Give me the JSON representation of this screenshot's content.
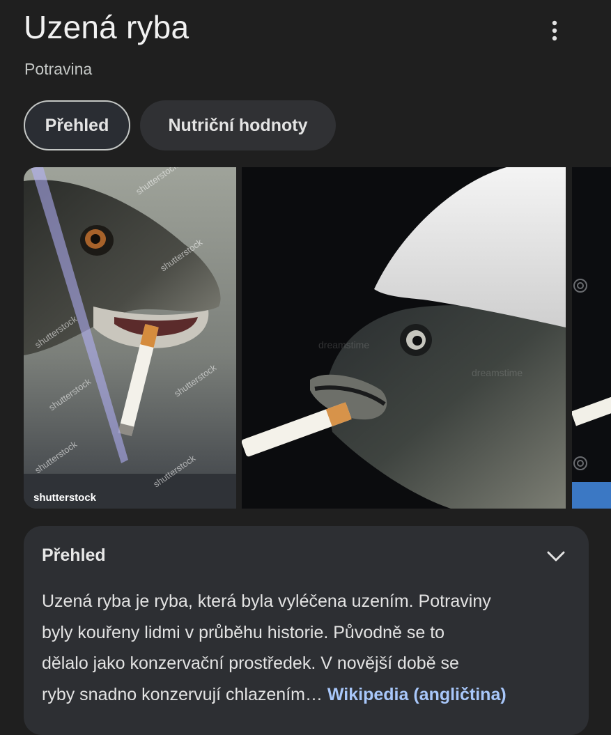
{
  "header": {
    "title": "Uzená ryba",
    "subtitle": "Potravina",
    "more_icon": "more-vert-icon"
  },
  "tabs": [
    {
      "label": "Přehled",
      "active": true
    },
    {
      "label": "Nutriční hodnoty",
      "active": false
    }
  ],
  "gallery": {
    "images": [
      {
        "subject": "fish with cigarette",
        "watermark": "shutterstock"
      },
      {
        "subject": "fish with cigarette and white cap"
      },
      {
        "subject": "partially visible image"
      }
    ]
  },
  "overview": {
    "heading": "Přehled",
    "chevron_icon": "chevron-down-icon",
    "lines": [
      "Uzená ryba je ryba, která byla vyléčena uzením. Potraviny",
      "byly kouřeny lidmi v průběhu historie. Původně se to",
      "dělalo jako konzervační prostředek. V novější době se",
      "ryby snadno konzervují chlazením"
    ],
    "ellipsis": "…",
    "link_label": "Wikipedia (angličtina)"
  },
  "colors": {
    "background": "#1f1f1f",
    "chip_inactive": "#303134",
    "card": "#2d2f33",
    "link": "#a8c7fa"
  }
}
